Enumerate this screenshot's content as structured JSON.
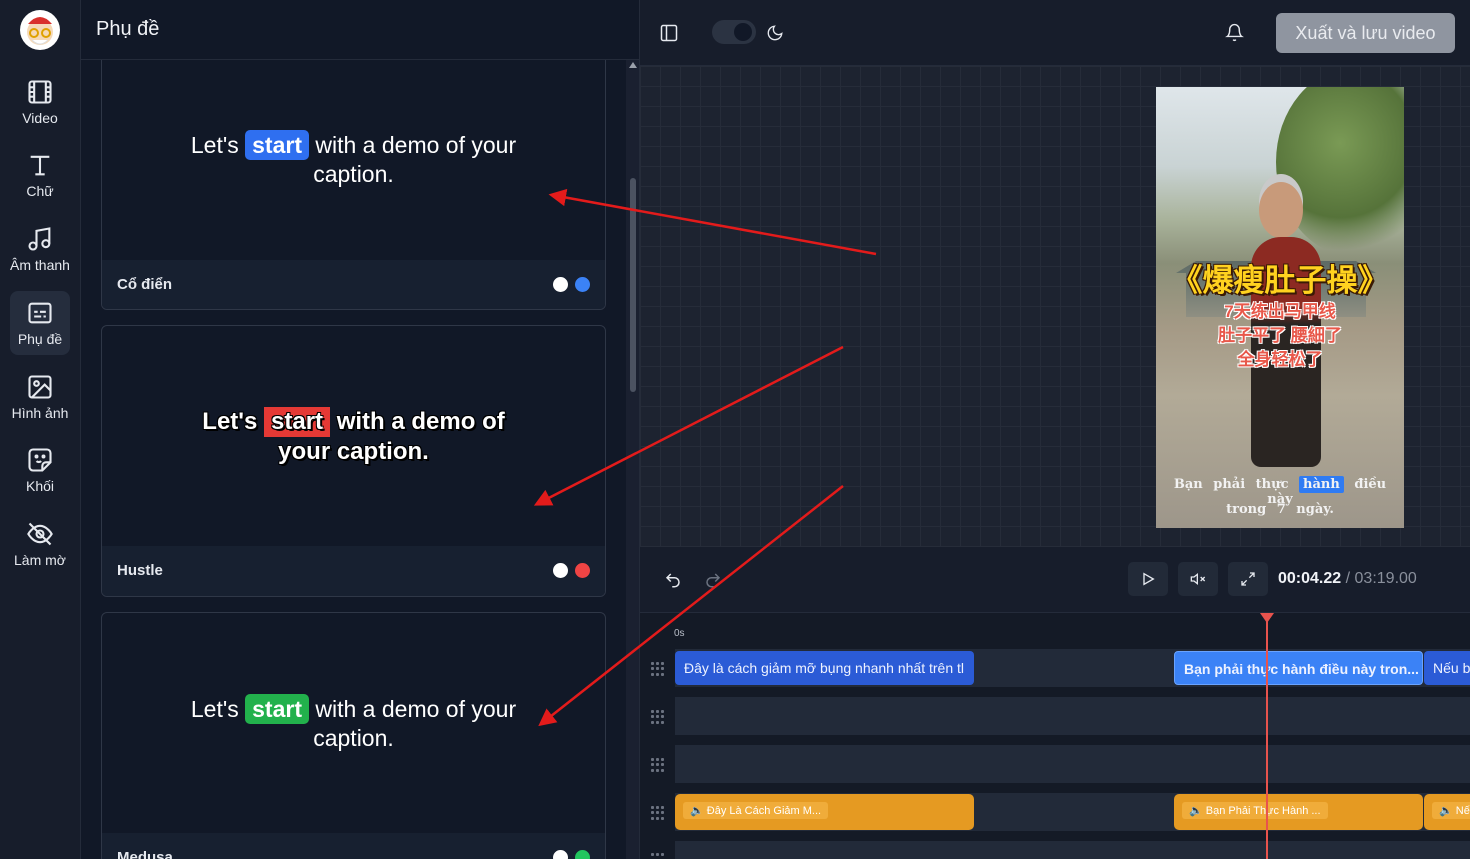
{
  "sidebar": {
    "items": [
      {
        "label": "Video",
        "icon": "film-icon"
      },
      {
        "label": "Chữ",
        "icon": "text-icon"
      },
      {
        "label": "Âm thanh",
        "icon": "music-icon"
      },
      {
        "label": "Phụ đề",
        "icon": "subtitles-icon",
        "active": true
      },
      {
        "label": "Hình ảnh",
        "icon": "image-icon"
      },
      {
        "label": "Khối",
        "icon": "sticker-icon"
      },
      {
        "label": "Làm mờ",
        "icon": "eye-off-icon"
      }
    ]
  },
  "panel": {
    "title": "Phụ đề",
    "cards": [
      {
        "name": "Cổ điển",
        "before": "Let's",
        "highlight": "start",
        "after": "with a demo of your",
        "line2": "caption.",
        "highlight_color": "#2f6ff0",
        "dots": [
          "#ffffff",
          "#3b82f6"
        ]
      },
      {
        "name": "Hustle",
        "before": "Let's",
        "highlight": "start",
        "after": "with a demo of",
        "line2": "your caption.",
        "highlight_color": "#e53935",
        "dots": [
          "#ffffff",
          "#ef4444"
        ]
      },
      {
        "name": "Medusa",
        "before": "Let's",
        "highlight": "start",
        "after": "with a demo of your",
        "line2": "caption.",
        "highlight_color": "#22b14c",
        "dots": [
          "#ffffff",
          "#22c55e"
        ]
      }
    ]
  },
  "topbar": {
    "export_label": "Xuất và lưu video",
    "icons": [
      "sidebar-toggle-icon",
      "theme-toggle",
      "moon-icon",
      "bell-icon"
    ]
  },
  "video": {
    "title": "《爆瘦肚子操》",
    "sub_lines": [
      "7天练出马甲线",
      "肚子平了 腰細了",
      "全身轻松了"
    ],
    "caption_before": "Bạn phải thực",
    "caption_highlight": "hành",
    "caption_after": "điều này",
    "caption_line2": "trong 7 ngày."
  },
  "playback": {
    "current_time": "00:04.22",
    "separator": "/",
    "total_time": "03:19.00"
  },
  "timeline": {
    "ruler_label": "0s",
    "caption_clips": [
      "Đây là cách giảm mỡ bụng nhanh nhất trên tl",
      "Bạn phải thực hành điều này tron...",
      "Nếu b"
    ],
    "audio_clips": [
      "Đây Là Cách Giảm M...",
      "Bạn Phải Thực Hành ...",
      "Nế"
    ]
  },
  "colors": {
    "accent": "#3b82f6",
    "annotation_arrow": "#e31b1b",
    "playhead": "#e8534d",
    "audio_clip": "#e59a22"
  }
}
